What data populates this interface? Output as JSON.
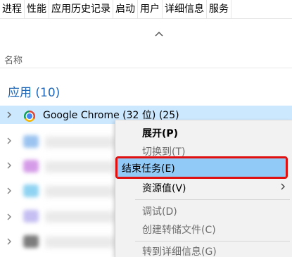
{
  "tabs": [
    "进程",
    "性能",
    "应用历史记录",
    "启动",
    "用户",
    "详细信息",
    "服务"
  ],
  "column_header": "名称",
  "group": {
    "title": "应用 (10)"
  },
  "rows": [
    {
      "label": "Google Chrome (32 位) (25)",
      "icon": "chrome-icon",
      "selected": true
    }
  ],
  "context_menu": {
    "items": [
      {
        "label": "展开(P)",
        "state": "bold"
      },
      {
        "label": "切换到(T)",
        "state": "disabled"
      },
      {
        "label": "结束任务(E)",
        "state": "highlighted"
      },
      {
        "label": "资源值(V)",
        "state": "submenu"
      },
      {
        "label": "调试(D)",
        "state": "disabled"
      },
      {
        "label": "创建转储文件(C)",
        "state": "disabled"
      },
      {
        "label": "转到详细信息(G)",
        "state": "disabled"
      }
    ]
  },
  "colors": {
    "selection": "#cce8ff",
    "menu_highlight": "#91c9f7",
    "annotation_box": "#e01010",
    "group_title": "#1f66b5"
  }
}
